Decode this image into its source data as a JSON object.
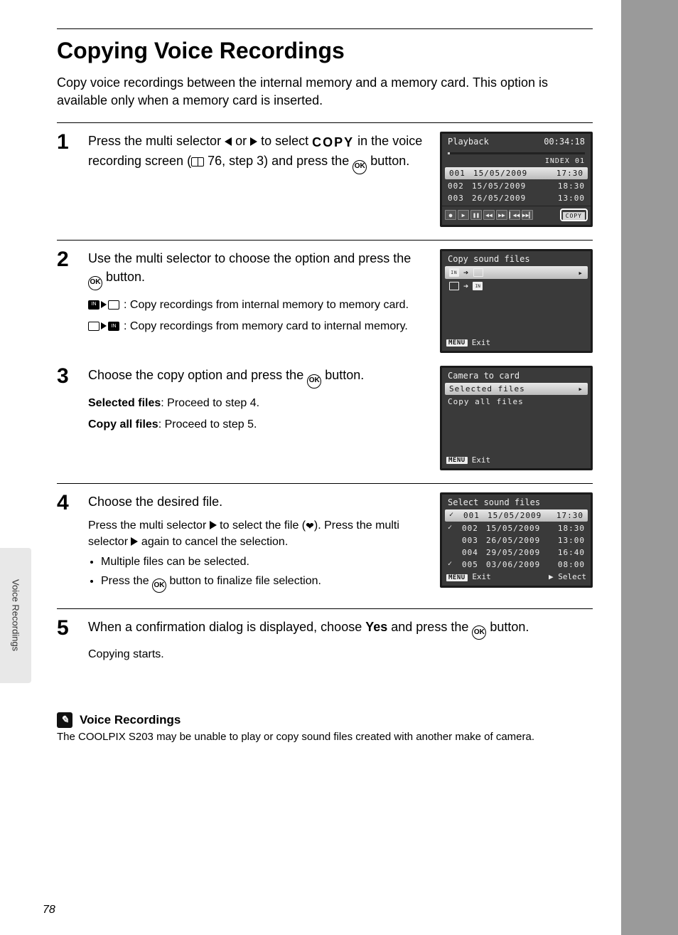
{
  "page": {
    "title": "Copying Voice Recordings",
    "intro": "Copy voice recordings between the internal memory and a memory card. This option is available only when a memory card is inserted.",
    "side_tab": "Voice Recordings",
    "number": "78"
  },
  "step1": {
    "text_a": "Press the multi selector ",
    "text_b": " or ",
    "text_c": " to select ",
    "copy_word": "COPY",
    "text_d": " in the voice recording screen (",
    "ref": " 76, step 3) and press the ",
    "text_e": " button.",
    "lcd": {
      "title": "Playback",
      "time": "00:34:18",
      "index": "INDEX 01",
      "rows": [
        {
          "num": "001",
          "date": "15/05/2009",
          "t": "17:30",
          "hi": true
        },
        {
          "num": "002",
          "date": "15/05/2009",
          "t": "18:30",
          "hi": false
        },
        {
          "num": "003",
          "date": "26/05/2009",
          "t": "13:00",
          "hi": false
        }
      ],
      "copy_label": "COPY"
    }
  },
  "step2": {
    "text_a": "Use the multi selector to choose the option and press the ",
    "text_b": " button.",
    "def1": ": Copy recordings from internal memory to memory card.",
    "def2": ": Copy recordings from memory card to internal memory.",
    "lcd": {
      "title": "Copy sound files",
      "exit": "Exit",
      "menu": "MENU"
    }
  },
  "step3": {
    "text_a": "Choose the copy option and press the ",
    "text_b": " button.",
    "sel_label": "Selected files",
    "sel_desc": ": Proceed to step 4.",
    "all_label": "Copy all files",
    "all_desc": ": Proceed to step 5.",
    "lcd": {
      "title": "Camera to card",
      "opt1": "Selected files",
      "opt2": "Copy all files",
      "exit": "Exit",
      "menu": "MENU"
    }
  },
  "step4": {
    "heading": "Choose the desired file.",
    "p1a": "Press the multi selector ",
    "p1b": " to select the file (",
    "p1c": "). Press the multi selector ",
    "p1d": " again to cancel the selection.",
    "li1": "Multiple files can be selected.",
    "li2a": "Press the ",
    "li2b": " button to finalize file selection.",
    "lcd": {
      "title": "Select sound files",
      "rows": [
        {
          "chk": "✓",
          "num": "001",
          "date": "15/05/2009",
          "t": "17:30",
          "hi": true
        },
        {
          "chk": "✓",
          "num": "002",
          "date": "15/05/2009",
          "t": "18:30",
          "hi": false
        },
        {
          "chk": "",
          "num": "003",
          "date": "26/05/2009",
          "t": "13:00",
          "hi": false
        },
        {
          "chk": "",
          "num": "004",
          "date": "29/05/2009",
          "t": "16:40",
          "hi": false
        },
        {
          "chk": "✓",
          "num": "005",
          "date": "03/06/2009",
          "t": "08:00",
          "hi": false
        }
      ],
      "exit": "Exit",
      "menu": "MENU",
      "select": "Select"
    }
  },
  "step5": {
    "text_a": "When a confirmation dialog is displayed, choose ",
    "yes": "Yes",
    "text_b": " and press the ",
    "text_c": " button.",
    "sub": "Copying starts."
  },
  "note": {
    "heading": "Voice Recordings",
    "body": "The COOLPIX S203 may be unable to play or copy sound files created with another make of camera."
  }
}
